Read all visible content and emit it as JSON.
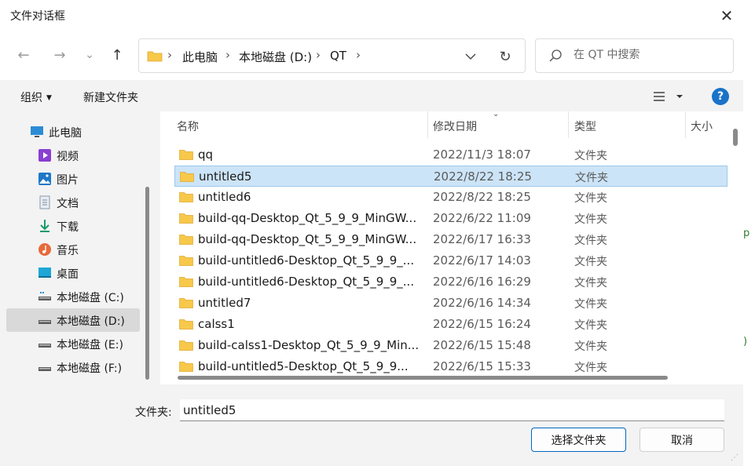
{
  "window": {
    "title": "文件对话框",
    "close_glyph": "✕"
  },
  "nav": {
    "back_glyph": "←",
    "forward_glyph": "→",
    "recent_glyph": "⌄",
    "up_glyph": "↑",
    "breadcrumb": [
      "此电脑",
      "本地磁盘 (D:)",
      "QT"
    ],
    "separator": "›",
    "refresh_glyph": "↻",
    "search_placeholder": "在 QT 中搜索"
  },
  "toolbar": {
    "organize_label": "组织",
    "new_folder_label": "新建文件夹",
    "help_glyph": "?"
  },
  "sidebar": {
    "items": [
      {
        "label": "此电脑",
        "icon": "computer-icon",
        "selected": false
      },
      {
        "label": "视频",
        "icon": "video-icon",
        "selected": false
      },
      {
        "label": "图片",
        "icon": "picture-icon",
        "selected": false
      },
      {
        "label": "文档",
        "icon": "document-icon",
        "selected": false
      },
      {
        "label": "下载",
        "icon": "download-icon",
        "selected": false
      },
      {
        "label": "音乐",
        "icon": "music-icon",
        "selected": false
      },
      {
        "label": "桌面",
        "icon": "desktop-icon",
        "selected": false
      },
      {
        "label": "本地磁盘 (C:)",
        "icon": "drive-icon",
        "selected": false
      },
      {
        "label": "本地磁盘 (D:)",
        "icon": "drive-icon",
        "selected": true
      },
      {
        "label": "本地磁盘 (E:)",
        "icon": "drive-icon",
        "selected": false
      },
      {
        "label": "本地磁盘 (F:)",
        "icon": "drive-icon",
        "selected": false
      }
    ]
  },
  "columns": {
    "name": "名称",
    "modified": "修改日期",
    "type": "类型",
    "size": "大小",
    "sort_glyph": "⌄"
  },
  "files": [
    {
      "name": "qq",
      "modified": "2022/11/3 18:07",
      "type": "文件夹",
      "selected": false
    },
    {
      "name": "untitled5",
      "modified": "2022/8/22 18:25",
      "type": "文件夹",
      "selected": true
    },
    {
      "name": "untitled6",
      "modified": "2022/8/22 18:25",
      "type": "文件夹",
      "selected": false
    },
    {
      "name": "build-qq-Desktop_Qt_5_9_9_MinGW...",
      "modified": "2022/6/22 11:09",
      "type": "文件夹",
      "selected": false
    },
    {
      "name": "build-qq-Desktop_Qt_5_9_9_MinGW...",
      "modified": "2022/6/17 16:33",
      "type": "文件夹",
      "selected": false
    },
    {
      "name": "build-untitled6-Desktop_Qt_5_9_9_...",
      "modified": "2022/6/17 14:03",
      "type": "文件夹",
      "selected": false
    },
    {
      "name": "build-untitled6-Desktop_Qt_5_9_9_...",
      "modified": "2022/6/16 16:29",
      "type": "文件夹",
      "selected": false
    },
    {
      "name": "untitled7",
      "modified": "2022/6/16 14:34",
      "type": "文件夹",
      "selected": false
    },
    {
      "name": "calss1",
      "modified": "2022/6/15 16:24",
      "type": "文件夹",
      "selected": false
    },
    {
      "name": "build-calss1-Desktop_Qt_5_9_9_Min...",
      "modified": "2022/6/15 15:48",
      "type": "文件夹",
      "selected": false
    },
    {
      "name": "build-untitled5-Desktop_Qt_5_9_9...",
      "modified": "2022/6/15 15:33",
      "type": "文件夹",
      "selected": false
    }
  ],
  "bottom": {
    "folder_label": "文件夹:",
    "folder_value": "untitled5",
    "select_button": "选择文件夹",
    "cancel_button": "取消"
  },
  "colors": {
    "accent": "#0067c0",
    "selection": "#cce4f7",
    "folder": "#f7c84a"
  }
}
